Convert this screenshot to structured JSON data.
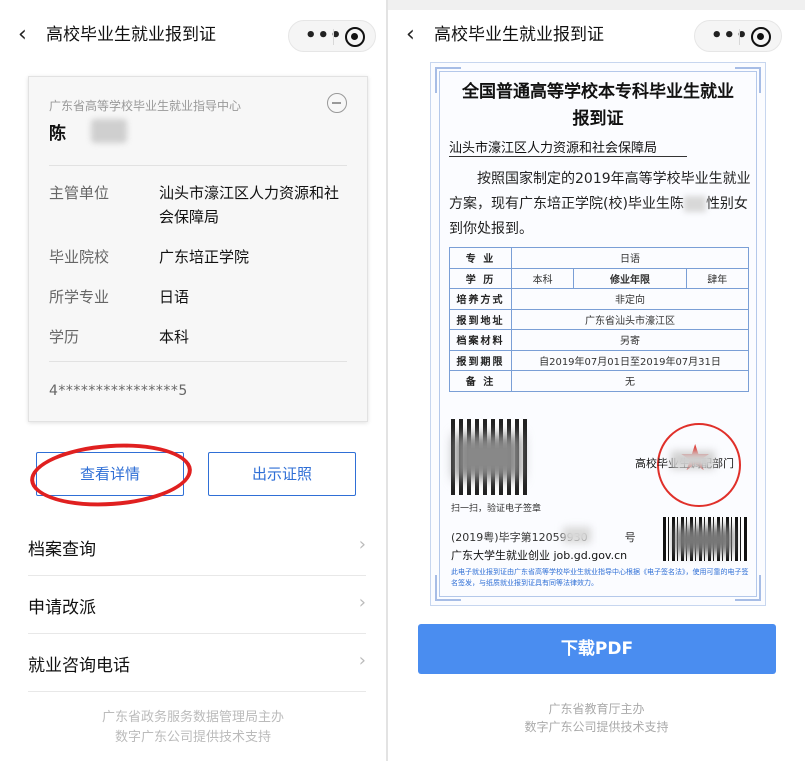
{
  "left": {
    "nav": {
      "back": "‹",
      "title": "高校毕业生就业报到证",
      "capsule_dots": "•••"
    },
    "card": {
      "org": "广东省高等学校毕业生就业指导中心",
      "name": "陈",
      "rows": [
        {
          "key": "主管单位",
          "value": "汕头市濠江区人力资源和社会保障局"
        },
        {
          "key": "毕业院校",
          "value": "广东培正学院"
        },
        {
          "key": "所学专业",
          "value": "日语"
        },
        {
          "key": "学历",
          "value": "本科"
        }
      ],
      "id_number": "4****************5"
    },
    "buttons": {
      "details": "查看详情",
      "show_cert": "出示证照"
    },
    "menu": [
      {
        "label": "档案查询"
      },
      {
        "label": "申请改派"
      },
      {
        "label": "就业咨询电话"
      }
    ],
    "chevron": "›",
    "footer": [
      "广东省政务服务数据管理局主办",
      "数字广东公司提供技术支持"
    ]
  },
  "right": {
    "nav": {
      "back": "‹",
      "title": "高校毕业生就业报到证",
      "capsule_dots": "•••"
    },
    "cert": {
      "title_line1": "全国普通高等学校本专科毕业生就业",
      "title_line2": "报到证",
      "bureau": "汕头市濠江区人力资源和社会保障局",
      "para_a": "按照国家制定的2019年高等学校毕业生就业方案，现有广东培正学院(校)毕业生陈",
      "para_b": "性别女到你处报到。",
      "table": {
        "major_label": "专 业",
        "major": "日语",
        "edu_label": "学 历",
        "edu": "本科",
        "years_label": "修业年限",
        "years": "肆年",
        "mode_label": "培养方式",
        "mode": "非定向",
        "addr_label": "报到地址",
        "addr": "广东省汕头市濠江区",
        "file_label": "档案材料",
        "file": "另寄",
        "period_label": "报到期限",
        "period": "自2019年07月01日至2019年07月31日",
        "note_label": "备 注",
        "note": "无"
      },
      "qr_caption": "扫一扫，验证电子签章",
      "seal_text": "高校毕业生调配部门",
      "doc_no_a": "(2019粤)毕字第12059930",
      "doc_no_b": "号",
      "website": "广东大学生就业创业 job.gd.gov.cn",
      "notice": "此电子就业报到证由广东省高等学校毕业生就业指导中心根据《电子签名法》，使用可靠的电子签名签发，与纸质就业报到证具有同等法律效力。"
    },
    "download": "下载PDF",
    "footer": [
      "广东省教育厅主办",
      "数字广东公司提供技术支持"
    ]
  },
  "colors": {
    "accent": "#2f6fd6",
    "download_bg": "#4a8df0",
    "seal": "#e0302a",
    "annotation": "#e02020"
  }
}
